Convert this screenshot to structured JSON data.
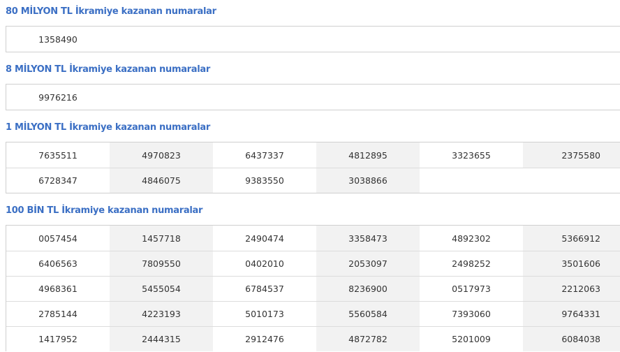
{
  "sections": [
    {
      "title": "80 MİLYON TL İkramiye kazanan numaralar",
      "rows": [
        [
          "1358490"
        ]
      ]
    },
    {
      "title": "8 MİLYON TL İkramiye kazanan numaralar",
      "rows": [
        [
          "9976216"
        ]
      ]
    },
    {
      "title": "1 MİLYON TL İkramiye kazanan numaralar",
      "rows": [
        [
          "7635511",
          "4970823",
          "6437337",
          "4812895",
          "3323655",
          "2375580"
        ],
        [
          "6728347",
          "4846075",
          "9383550",
          "3038866"
        ]
      ]
    },
    {
      "title": "100 BİN TL İkramiye kazanan numaralar",
      "rows": [
        [
          "0057454",
          "1457718",
          "2490474",
          "3358473",
          "4892302",
          "5366912"
        ],
        [
          "6406563",
          "7809550",
          "0402010",
          "2053097",
          "2498252",
          "3501606"
        ],
        [
          "4968361",
          "5455054",
          "6784537",
          "8236900",
          "0517973",
          "2212063"
        ],
        [
          "2785144",
          "4223193",
          "5010173",
          "5560584",
          "7393060",
          "9764331"
        ],
        [
          "1417952",
          "2444315",
          "2912476",
          "4872782",
          "5201009",
          "6084038"
        ]
      ]
    }
  ]
}
